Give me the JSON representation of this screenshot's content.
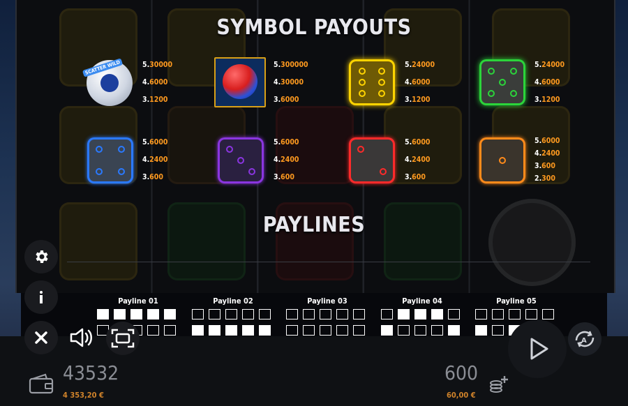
{
  "titles": {
    "symbol_payouts": "SYMBOL PAYOUTS",
    "paylines": "PAYLINES"
  },
  "symbols": [
    {
      "name": "scatter-wild",
      "badge": "SCATTER WILD",
      "pays": [
        {
          "n": "5.",
          "v": "30000"
        },
        {
          "n": "4.",
          "v": "6000"
        },
        {
          "n": "3.",
          "v": "1200"
        }
      ]
    },
    {
      "name": "atom",
      "pays": [
        {
          "n": "5.",
          "v": "300000"
        },
        {
          "n": "4.",
          "v": "30000"
        },
        {
          "n": "3.",
          "v": "6000"
        }
      ]
    },
    {
      "name": "yellow-die",
      "color": "#ffd400",
      "pays": [
        {
          "n": "5.",
          "v": "24000"
        },
        {
          "n": "4.",
          "v": "6000"
        },
        {
          "n": "3.",
          "v": "1200"
        }
      ]
    },
    {
      "name": "green-die",
      "color": "#2bd43a",
      "pays": [
        {
          "n": "5.",
          "v": "24000"
        },
        {
          "n": "4.",
          "v": "6000"
        },
        {
          "n": "3.",
          "v": "1200"
        }
      ]
    },
    {
      "name": "blue-die",
      "color": "#2a79ff",
      "pays": [
        {
          "n": "5.",
          "v": "6000"
        },
        {
          "n": "4.",
          "v": "2400"
        },
        {
          "n": "3.",
          "v": "600"
        }
      ]
    },
    {
      "name": "purple-die",
      "color": "#8a35e0",
      "pays": [
        {
          "n": "5.",
          "v": "6000"
        },
        {
          "n": "4.",
          "v": "2400"
        },
        {
          "n": "3.",
          "v": "600"
        }
      ]
    },
    {
      "name": "red-die",
      "color": "#ff2a2a",
      "pays": [
        {
          "n": "5.",
          "v": "6000"
        },
        {
          "n": "4.",
          "v": "2400"
        },
        {
          "n": "3.",
          "v": "600"
        }
      ]
    },
    {
      "name": "orange-die",
      "color": "#ff8a1a",
      "pays": [
        {
          "n": "5.",
          "v": "6000"
        },
        {
          "n": "4.",
          "v": "2400"
        },
        {
          "n": "3.",
          "v": "600"
        },
        {
          "n": "2.",
          "v": "300"
        }
      ]
    }
  ],
  "paylines": [
    {
      "label": "Payline 01",
      "rows": [
        [
          1,
          1,
          1,
          1,
          1
        ],
        [
          0,
          0,
          0,
          0,
          0
        ]
      ]
    },
    {
      "label": "Payline 02",
      "rows": [
        [
          0,
          0,
          0,
          0,
          0
        ],
        [
          1,
          1,
          1,
          1,
          1
        ]
      ]
    },
    {
      "label": "Payline 03",
      "rows": [
        [
          0,
          0,
          0,
          0,
          0
        ],
        [
          0,
          0,
          0,
          0,
          0
        ]
      ]
    },
    {
      "label": "Payline 04",
      "rows": [
        [
          0,
          1,
          1,
          1,
          0
        ],
        [
          1,
          0,
          0,
          0,
          1
        ]
      ]
    },
    {
      "label": "Payline 05",
      "rows": [
        [
          0,
          0,
          0,
          0,
          0
        ],
        [
          1,
          0,
          1,
          0,
          1
        ]
      ]
    }
  ],
  "footer": {
    "balance_credits": "43532",
    "balance_money": "4 353,20 €",
    "bet_credits": "600",
    "bet_money": "60,00 €"
  },
  "icons": [
    "gear-icon",
    "info-icon",
    "close-icon",
    "speaker-icon",
    "fullscreen-icon",
    "play-icon",
    "autoplay-icon",
    "wallet-icon",
    "coins-icon"
  ],
  "colors": {
    "accent": "#ff9a1f",
    "money": "#d0832a"
  }
}
